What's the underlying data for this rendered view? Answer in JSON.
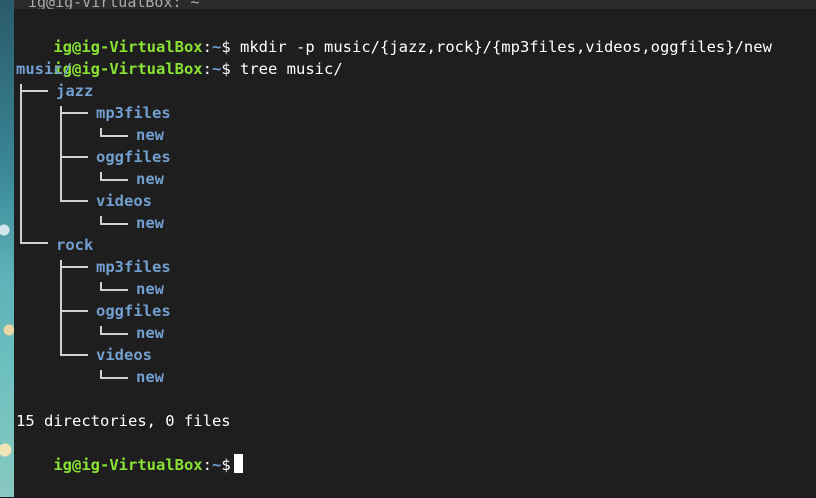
{
  "window": {
    "partial_title": "ig@ig-VirtualBox: ~"
  },
  "prompt": {
    "user_host": "ig@ig-VirtualBox",
    "sep": ":",
    "path": "~",
    "symbol": "$"
  },
  "commands": [
    "mkdir -p music/{jazz,rock}/{mp3files,videos,oggfiles}/new",
    "tree music/"
  ],
  "tree": {
    "root": "music/",
    "jazz": {
      "name": "jazz",
      "mp3files": "mp3files",
      "mp3files_new": "new",
      "oggfiles": "oggfiles",
      "oggfiles_new": "new",
      "videos": "videos",
      "videos_new": "new"
    },
    "rock": {
      "name": "rock",
      "mp3files": "mp3files",
      "mp3files_new": "new",
      "oggfiles": "oggfiles",
      "oggfiles_new": "new",
      "videos": "videos",
      "videos_new": "new"
    }
  },
  "summary": "15 directories, 0 files",
  "colors": {
    "background": "#1e1e1e",
    "prompt_user": "#8ae234",
    "directory": "#729fcf",
    "text": "#ffffff"
  }
}
